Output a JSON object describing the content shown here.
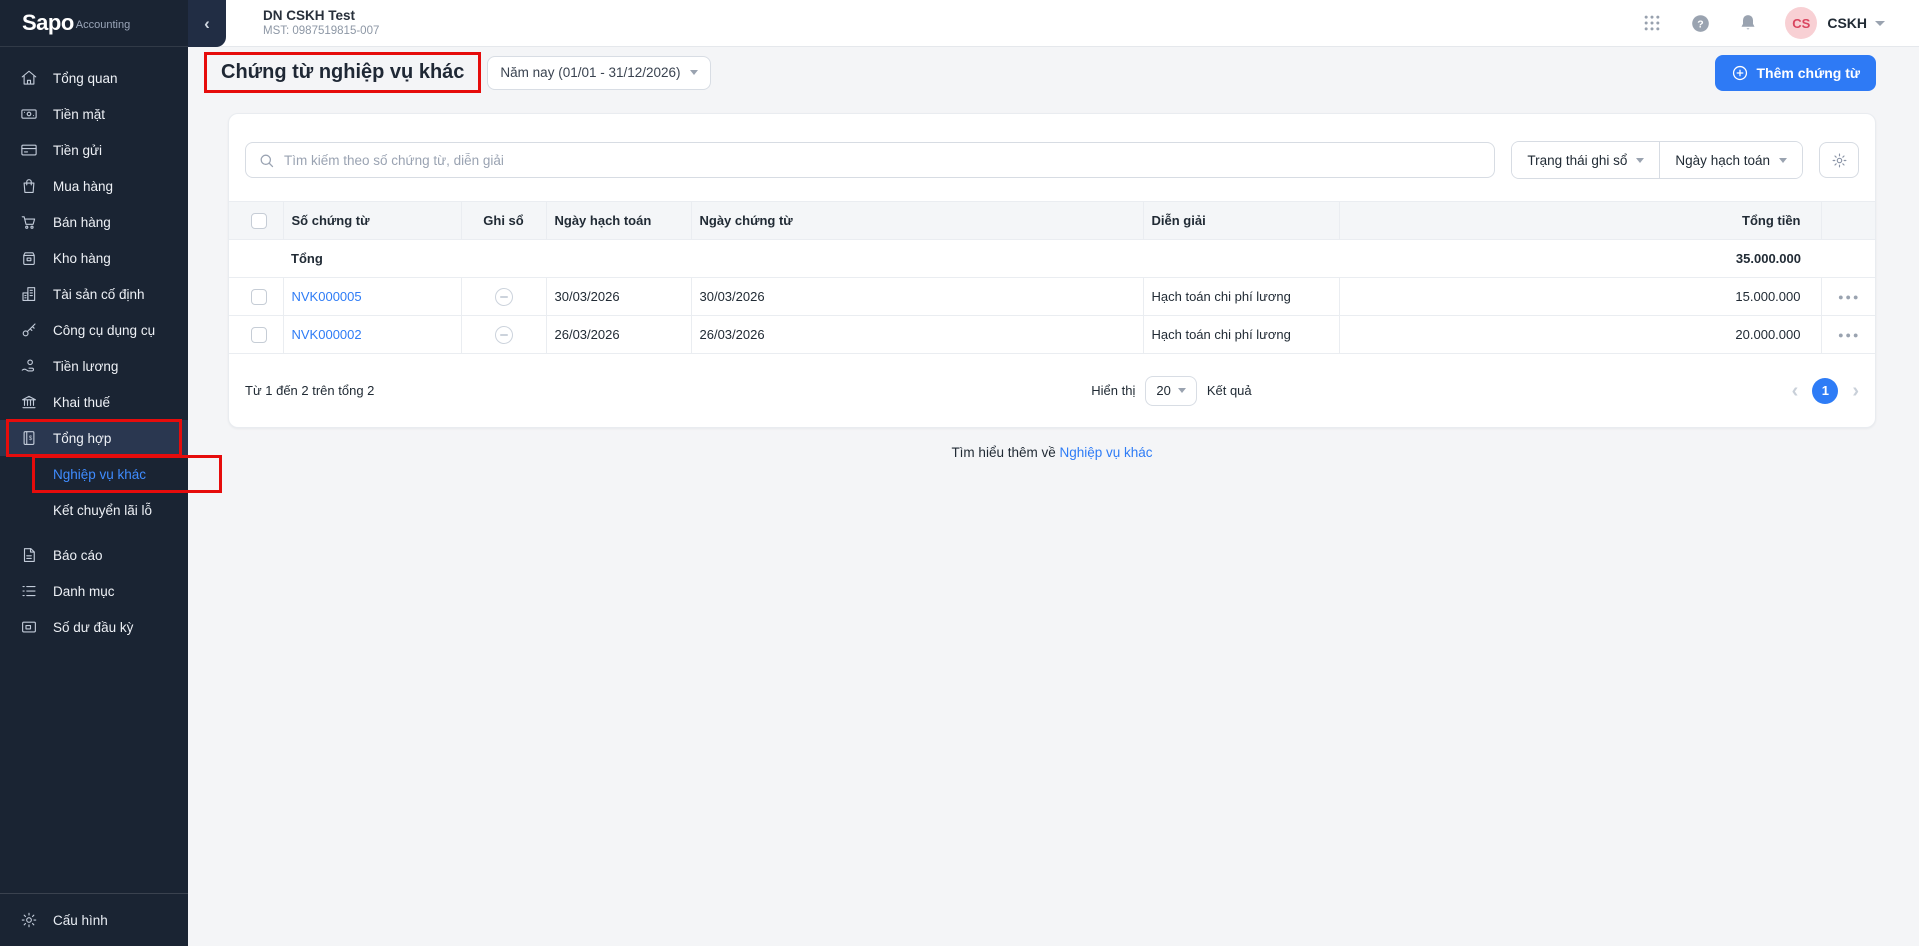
{
  "colors": {
    "accent": "#2e7af5",
    "link": "#2e7cf6",
    "annotation_red": "#e60c0c",
    "sidebar_bg": "#1a2433",
    "active_item_bg": "#2a3750",
    "avatar_bg": "#f8d0d4",
    "avatar_text": "#d9455f"
  },
  "sidebar": {
    "logo": {
      "brand": "Sapo",
      "suffix": "Accounting"
    },
    "items": [
      {
        "label": "Tổng quan",
        "icon": "home-icon"
      },
      {
        "label": "Tiền mặt",
        "icon": "cash-icon"
      },
      {
        "label": "Tiền gửi",
        "icon": "bank-card-icon"
      },
      {
        "label": "Mua hàng",
        "icon": "shopping-bag-icon"
      },
      {
        "label": "Bán hàng",
        "icon": "cart-icon"
      },
      {
        "label": "Kho hàng",
        "icon": "warehouse-icon"
      },
      {
        "label": "Tài sản cố định",
        "icon": "building-icon"
      },
      {
        "label": "Công cụ dụng cụ",
        "icon": "key-icon"
      },
      {
        "label": "Tiền lương",
        "icon": "payroll-icon"
      },
      {
        "label": "Khai thuế",
        "icon": "tax-bank-icon"
      },
      {
        "label": "Tổng hợp",
        "icon": "ledger-icon",
        "active": true,
        "annotated": true
      }
    ],
    "subitems": [
      {
        "label": "Nghiệp vụ khác",
        "active": true,
        "annotated": true
      },
      {
        "label": "Kết chuyển lãi lỗ"
      }
    ],
    "items2": [
      {
        "label": "Báo cáo",
        "icon": "report-icon"
      },
      {
        "label": "Danh mục",
        "icon": "list-icon"
      },
      {
        "label": "Số dư đầu kỳ",
        "icon": "wallet-icon"
      }
    ],
    "footer_item": {
      "label": "Cấu hình",
      "icon": "gear-icon"
    },
    "collapse_icon": "chevron-left-icon"
  },
  "header": {
    "company": "DN CSKH Test",
    "tax_code": "MST: 0987519815-007",
    "icons": [
      "apps-grid-icon",
      "help-icon",
      "bell-icon",
      "chevron-down-icon"
    ],
    "user": {
      "initials": "CS",
      "name": "CSKH"
    }
  },
  "page": {
    "title": "Chứng từ nghiệp vụ khác",
    "date_filter": "Năm nay (01/01 - 31/12/2026)",
    "add_button": "Thêm chứng từ",
    "search_placeholder": "Tìm kiếm theo số chứng từ, diễn giải",
    "filters": {
      "posting_status": "Trạng thái ghi sổ",
      "posting_date": "Ngày hạch toán"
    }
  },
  "table": {
    "columns": {
      "doc_no": "Số chứng từ",
      "posted": "Ghi sổ",
      "posting_date": "Ngày hạch toán",
      "doc_date": "Ngày chứng từ",
      "description": "Diễn giải",
      "total": "Tổng tiền"
    },
    "total_label": "Tổng",
    "total_amount": "35.000.000",
    "rows": [
      {
        "id": "NVK000005",
        "posting_date": "30/03/2026",
        "doc_date": "30/03/2026",
        "description": "Hạch toán chi phí lương",
        "amount": "15.000.000",
        "status_icon": "circle-minus-icon"
      },
      {
        "id": "NVK000002",
        "posting_date": "26/03/2026",
        "doc_date": "26/03/2026",
        "description": "Hạch toán chi phí lương",
        "amount": "20.000.000",
        "status_icon": "circle-minus-icon"
      }
    ]
  },
  "pagination": {
    "summary": "Từ 1 đến 2 trên tổng 2",
    "show_label": "Hiển thị",
    "page_size": "20",
    "results_label": "Kết quả",
    "current_page": "1"
  },
  "footer_link": {
    "text": "Tìm hiểu thêm về ",
    "link": "Nghiệp vụ khác"
  }
}
